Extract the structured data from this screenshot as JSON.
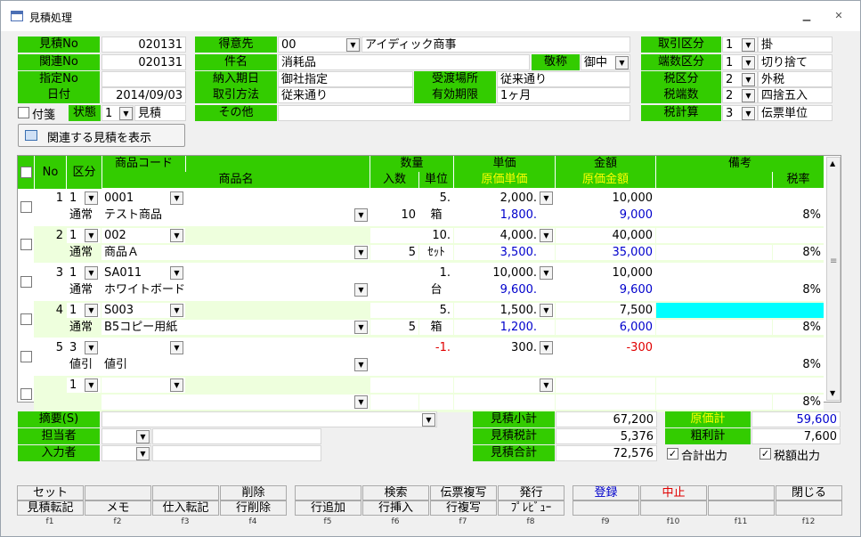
{
  "window": {
    "title": "見積処理",
    "minimize": "▁",
    "close": "✕"
  },
  "header_left": {
    "quote_no_label": "見積No",
    "quote_no": "020131",
    "related_no_label": "関連No",
    "related_no": "020131",
    "specified_no_label": "指定No",
    "specified_no": "",
    "date_label": "日付",
    "date": "2014/09/03",
    "sticky_label": "付箋",
    "status_label": "状態",
    "status_code": "1",
    "status_text": "見積",
    "related_button": "関連する見積を表示"
  },
  "header_mid": {
    "customer_label": "得意先",
    "customer_code": "00",
    "customer_name": "アイディック商事",
    "subject_label": "件名",
    "subject": "消耗品",
    "honorific_label": "敬称",
    "honorific": "御中",
    "delivery_date_label": "納入期日",
    "delivery_date": "御社指定",
    "delivery_place_label": "受渡場所",
    "delivery_place": "従来通り",
    "trade_method_label": "取引方法",
    "trade_method": "従来通り",
    "validity_label": "有効期限",
    "validity": "1ヶ月",
    "other_label": "その他",
    "other": ""
  },
  "header_right": {
    "rows": [
      {
        "label": "取引区分",
        "code": "1",
        "text": "掛"
      },
      {
        "label": "端数区分",
        "code": "1",
        "text": "切り捨て"
      },
      {
        "label": "税区分",
        "code": "2",
        "text": "外税"
      },
      {
        "label": "税端数",
        "code": "2",
        "text": "四捨五入"
      },
      {
        "label": "税計算",
        "code": "3",
        "text": "伝票単位"
      }
    ]
  },
  "grid": {
    "headers": {
      "no": "No",
      "kubun": "区分",
      "product_code": "商品コード",
      "product_name": "商品名",
      "quantity": "数量",
      "irisu": "入数",
      "unit": "単位",
      "unit_price": "単価",
      "cost_unit_price": "原価単価",
      "amount": "金額",
      "cost_amount": "原価金額",
      "remarks": "備考",
      "tax_rate": "税率"
    },
    "rows": [
      {
        "no": "1",
        "kubun_code": "1",
        "code": "0001",
        "type": "通常",
        "name": "テスト商品",
        "qty": "5.",
        "irisu": "10",
        "unit": "箱",
        "price": "2,000.",
        "cost_price": "1,800.",
        "amount": "10,000",
        "cost_amount": "9,000",
        "remark": "",
        "tax": "8%"
      },
      {
        "no": "2",
        "kubun_code": "1",
        "code": "002",
        "type": "通常",
        "name": "商品Ａ",
        "qty": "10.",
        "irisu": "5",
        "unit": "ｾｯﾄ",
        "price": "4,000.",
        "cost_price": "3,500.",
        "amount": "40,000",
        "cost_amount": "35,000",
        "remark": "",
        "tax": "8%"
      },
      {
        "no": "3",
        "kubun_code": "1",
        "code": "SA011",
        "type": "通常",
        "name": "ホワイトボード",
        "qty": "1.",
        "irisu": "",
        "unit": "台",
        "price": "10,000.",
        "cost_price": "9,600.",
        "amount": "10,000",
        "cost_amount": "9,600",
        "remark": "",
        "tax": "8%"
      },
      {
        "no": "4",
        "kubun_code": "1",
        "code": "S003",
        "type": "通常",
        "name": "B5コピー用紙",
        "qty": "5.",
        "irisu": "5",
        "unit": "箱",
        "price": "1,500.",
        "cost_price": "1,200.",
        "amount": "7,500",
        "cost_amount": "6,000",
        "remark": "",
        "tax": "8%"
      },
      {
        "no": "5",
        "kubun_code": "3",
        "code": "",
        "type": "値引",
        "name": "値引",
        "qty": "-1.",
        "irisu": "",
        "unit": "",
        "price": "300.",
        "cost_price": "",
        "amount": "-300",
        "cost_amount": "",
        "remark": "",
        "tax": "8%"
      },
      {
        "no": "",
        "kubun_code": "1",
        "code": "",
        "type": "",
        "name": "",
        "qty": "",
        "irisu": "",
        "unit": "",
        "price": "",
        "cost_price": "",
        "amount": "",
        "cost_amount": "",
        "remark": "",
        "tax": "8%"
      }
    ]
  },
  "footer": {
    "summary_label": "摘要(S)",
    "summary": "",
    "staff_label": "担当者",
    "staff": "",
    "entry_label": "入力者",
    "entry": "",
    "subtotal_label": "見積小計",
    "subtotal": "67,200",
    "tax_label": "見積税計",
    "tax": "5,376",
    "total_label": "見積合計",
    "total": "72,576",
    "cost_total_label": "原価計",
    "cost_total": "59,600",
    "gross_label": "粗利計",
    "gross": "7,600",
    "sum_output_label": "合計出力",
    "tax_output_label": "税額出力"
  },
  "fkeys": [
    {
      "top": "セット",
      "bottom": "見積転記",
      "num": "f1"
    },
    {
      "top": "",
      "bottom": "メモ",
      "num": "f2"
    },
    {
      "top": "",
      "bottom": "仕入転記",
      "num": "f3"
    },
    {
      "top": "削除",
      "bottom": "行削除",
      "num": "f4"
    },
    {
      "top": "",
      "bottom": "行追加",
      "num": "f5"
    },
    {
      "top": "検索",
      "bottom": "行挿入",
      "num": "f6"
    },
    {
      "top": "伝票複写",
      "bottom": "行複写",
      "num": "f7"
    },
    {
      "top": "発行",
      "bottom": "ﾌﾟﾚﾋﾞｭｰ",
      "num": "f8"
    },
    {
      "top": "登録",
      "bottom": "",
      "num": "f9"
    },
    {
      "top": "中止",
      "bottom": "",
      "num": "f10"
    },
    {
      "top": "",
      "bottom": "",
      "num": "f11"
    },
    {
      "top": "閉じる",
      "bottom": "",
      "num": "f12"
    }
  ],
  "colors": {
    "label_green": "#33cc00",
    "row_alt": "#eeffdd",
    "highlight": "#00ffff",
    "blue": "#0000cc",
    "red": "#e00000",
    "yellow": "#ffff00"
  }
}
